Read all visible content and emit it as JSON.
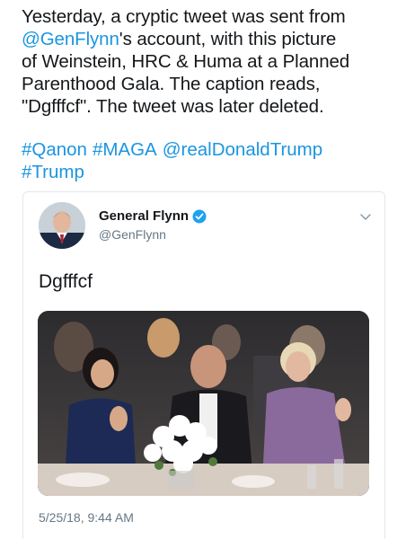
{
  "caption": {
    "line1": "Yesterday, a cryptic tweet was sent from",
    "mention": "@GenFlynn",
    "line2_rest": "'s account, with this picture",
    "line3": "of Weinstein, HRC & Huma at a Planned",
    "line4": "Parenthood Gala. The caption reads,",
    "line5": "\"Dgfffcf\". The tweet was later deleted."
  },
  "hashtags": [
    "#Qanon",
    "#MAGA",
    "@realDonaldTrump",
    "#Trump"
  ],
  "embedded_tweet": {
    "display_name": "General Flynn",
    "handle": "@GenFlynn",
    "verified": true,
    "text": "Dgfffcf",
    "timestamp": "5/25/18, 9:44 AM"
  },
  "colors": {
    "link": "#1b95e0",
    "text": "#14171a",
    "muted": "#657786",
    "border": "#e1e8ed"
  },
  "icons": [
    "verified-badge-icon",
    "chevron-down-icon"
  ]
}
